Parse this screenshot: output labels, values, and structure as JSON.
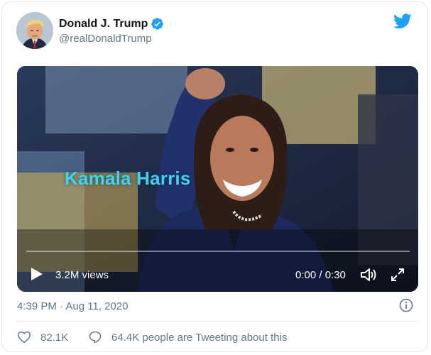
{
  "tweet": {
    "display_name": "Donald J. Trump",
    "handle": "@realDonaldTrump",
    "timestamp": "4:39 PM · Aug 11, 2020"
  },
  "video": {
    "overlay_text": "Kamala Harris",
    "views": "3.2M views",
    "time": "0:00 / 0:30",
    "progress": 0
  },
  "engagement": {
    "likes": "82.1K",
    "people_tweeting": "64.4K people are Tweeting about this"
  },
  "colors": {
    "accent": "#1da1f2",
    "secondary_text": "#657786",
    "overlay_text": "#3fd3ee"
  }
}
